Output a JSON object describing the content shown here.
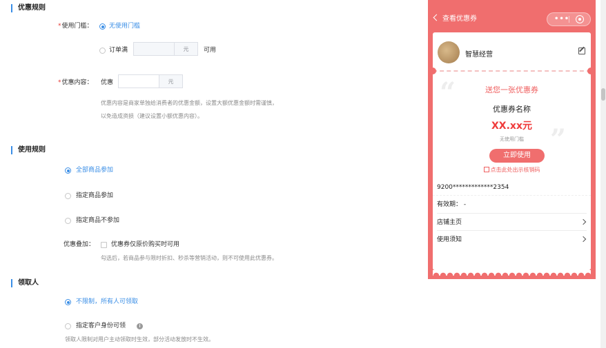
{
  "sections": {
    "discount_rules": "优惠规则",
    "usage_rules": "使用规则",
    "recipient": "领取人"
  },
  "threshold": {
    "label": "使用门槛：",
    "option_none": "无使用门槛",
    "option_order_full": "订单满",
    "unit": "元",
    "suffix": "可用"
  },
  "content": {
    "label": "优惠内容：",
    "prefix": "优惠",
    "unit": "元",
    "help_line1": "优惠内容是商家单独给消费者的优惠金额，设置大额优惠金额时需谨慎，",
    "help_line2": "以免造成资损（建议设置小额优惠内容）。"
  },
  "usage": {
    "option_all": "全部商品参加",
    "option_specific": "指定商品参加",
    "option_exclude": "指定商品不参加",
    "stack_label": "优惠叠加：",
    "stack_checkbox": "优惠券仅原价购买时可用",
    "stack_help": "勾选后，若商品参与限时折扣、秒杀等营销活动，则不可使用此优惠券。"
  },
  "recipient": {
    "option_unlimited": "不限制，所有人可领取",
    "option_identity": "指定客户身份可领",
    "info_icon": "i",
    "help": "领取人限制对用户主动领取时生效，部分活动发放时不生效。"
  },
  "preview": {
    "title": "查看优惠券",
    "capsule_dots": "•••",
    "shop_name": "智慧经营",
    "gift_title": "送您一张优惠券",
    "coupon_name": "优惠券名称",
    "coupon_value": "XX.xx元",
    "threshold_text": "无使用门槛",
    "use_button": "立即使用",
    "writeoff_text": "点击此处出示核销码",
    "code": "9200*************2354",
    "validity": "有效期：  -",
    "shop_home": "店铺主页",
    "usage_notes": "使用须知",
    "open_quote": "“",
    "close_quote": "”"
  },
  "icons": {
    "back": "back-arrow-icon",
    "more": "more-dots-icon",
    "close": "capsule-close-icon",
    "edit": "edit-icon",
    "qr": "qr-code-icon",
    "chevron": "chevron-right-icon",
    "info": "info-icon"
  },
  "colors": {
    "accent_blue": "#3a8ee6",
    "preview_red": "#f06e6e",
    "required_red": "#e53935"
  }
}
